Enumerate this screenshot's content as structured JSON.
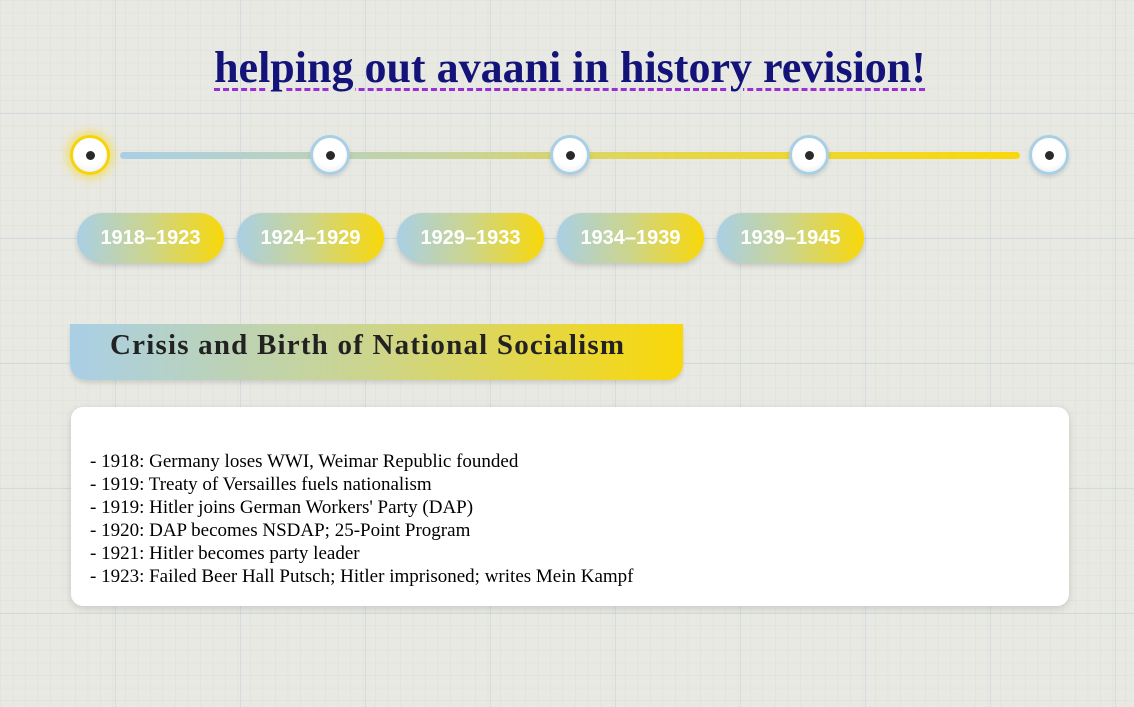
{
  "title": "helping out avaani in history revision!",
  "timeline": {
    "active_index": 0,
    "periods": [
      "1918–1923",
      "1924–1929",
      "1929–1933",
      "1934–1939",
      "1939–1945"
    ]
  },
  "section": {
    "title": "Crisis and Birth of National Socialism",
    "events": [
      "- 1918: Germany loses WWI, Weimar Republic founded",
      "- 1919: Treaty of Versailles fuels nationalism",
      "- 1919: Hitler joins German Workers' Party (DAP)",
      "- 1920: DAP becomes NSDAP; 25-Point Program",
      "- 1921: Hitler becomes party leader",
      "- 1923: Failed Beer Hall Putsch; Hitler imprisoned; writes Mein Kampf"
    ]
  },
  "colors": {
    "accent_blue": "#a9cfe6",
    "accent_yellow": "#f9d808",
    "title": "#13137a",
    "title_underline": "#9b2fd6"
  }
}
